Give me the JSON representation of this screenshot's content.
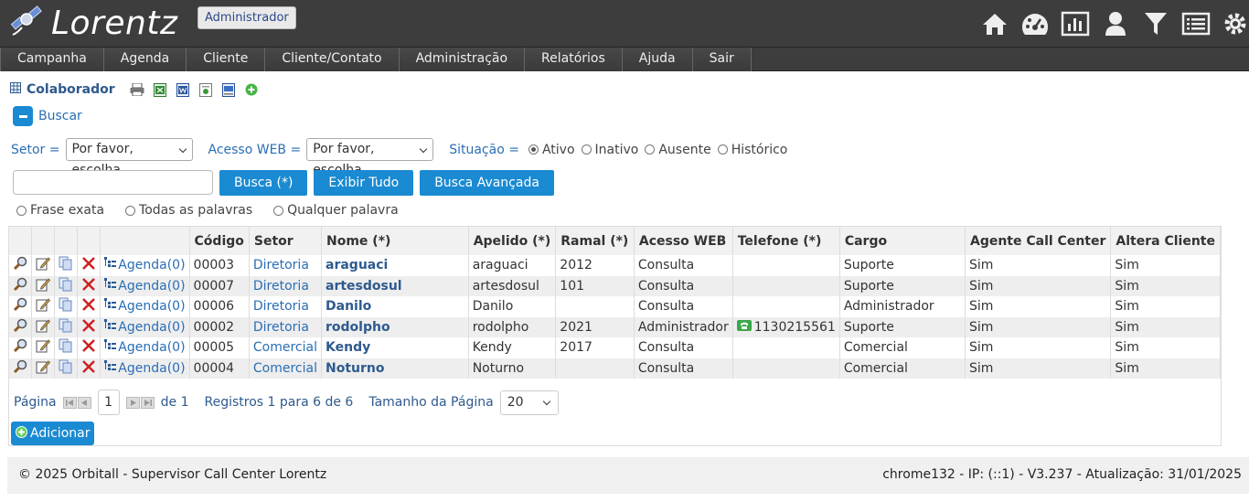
{
  "app": {
    "name": "Lorentz",
    "role": "Administrador"
  },
  "topbar": {
    "icons": [
      "home-icon",
      "dashboard-icon",
      "chart-icon",
      "user-icon",
      "filter-icon",
      "list-icon",
      "settings-icon"
    ]
  },
  "menu": {
    "items": [
      "Campanha",
      "Agenda",
      "Cliente",
      "Cliente/Contato",
      "Administração",
      "Relatórios",
      "Ajuda",
      "Sair"
    ]
  },
  "page": {
    "title": "Colaborador",
    "export_icons": [
      "print-icon",
      "excel-icon",
      "word-icon",
      "csv-icon",
      "report-icon",
      "add-circle-icon"
    ],
    "buscar_label": "Buscar"
  },
  "filters": {
    "setor_label": "Setor =",
    "setor_value": "Por favor, escolha",
    "acesso_label": "Acesso WEB =",
    "acesso_value": "Por favor, escolha",
    "situacao_label": "Situação =",
    "situacao_options": [
      "Ativo",
      "Inativo",
      "Ausente",
      "Histórico"
    ],
    "situacao_selected": "Ativo"
  },
  "search": {
    "value": "",
    "busca_btn": "Busca (*)",
    "exibir_btn": "Exibir Tudo",
    "avancada_btn": "Busca Avançada",
    "match_options": [
      "Frase exata",
      "Todas as palavras",
      "Qualquer palavra"
    ]
  },
  "table": {
    "columns": [
      "Código",
      "Setor",
      "Nome (*)",
      "Apelido (*)",
      "Ramal (*)",
      "Acesso WEB",
      "Telefone (*)",
      "Cargo",
      "Agente Call Center",
      "Altera Cliente"
    ],
    "agenda_label": "Agenda(0)",
    "rows": [
      {
        "codigo": "00003",
        "setor": "Diretoria",
        "nome": "araguaci",
        "apelido": "araguaci",
        "ramal": "2012",
        "acesso": "Consulta",
        "telefone": "",
        "cargo": "Suporte",
        "agente": "Sim",
        "altera": "Sim"
      },
      {
        "codigo": "00007",
        "setor": "Diretoria",
        "nome": "artesdosul",
        "apelido": "artesdosul",
        "ramal": "101",
        "acesso": "Consulta",
        "telefone": "",
        "cargo": "Suporte",
        "agente": "Sim",
        "altera": "Sim"
      },
      {
        "codigo": "00006",
        "setor": "Diretoria",
        "nome": "Danilo",
        "apelido": "Danilo",
        "ramal": "",
        "acesso": "Consulta",
        "telefone": "",
        "cargo": "Administrador",
        "agente": "Sim",
        "altera": "Sim"
      },
      {
        "codigo": "00002",
        "setor": "Diretoria",
        "nome": "rodolpho",
        "apelido": "rodolpho",
        "ramal": "2021",
        "acesso": "Administrador",
        "telefone": "1130215561",
        "cargo": "Suporte",
        "agente": "Sim",
        "altera": "Sim"
      },
      {
        "codigo": "00005",
        "setor": "Comercial",
        "nome": "Kendy",
        "apelido": "Kendy",
        "ramal": "2017",
        "acesso": "Consulta",
        "telefone": "",
        "cargo": "Comercial",
        "agente": "Sim",
        "altera": "Sim"
      },
      {
        "codigo": "00004",
        "setor": "Comercial",
        "nome": "Noturno",
        "apelido": "Noturno",
        "ramal": "",
        "acesso": "Consulta",
        "telefone": "",
        "cargo": "Comercial",
        "agente": "Sim",
        "altera": "Sim"
      }
    ]
  },
  "pager": {
    "pagina_label": "Página",
    "page": "1",
    "of_label": "de 1",
    "registros": "Registros 1 para 6 de 6",
    "tamanho_label": "Tamanho da Página",
    "tamanho_value": "20"
  },
  "add_btn": "Adicionar",
  "footer": {
    "left": "© 2025 Orbitall - Supervisor Call Center Lorentz",
    "right": "chrome132 - IP: (::1) - V3.237 - Atualização: 31/01/2025"
  }
}
